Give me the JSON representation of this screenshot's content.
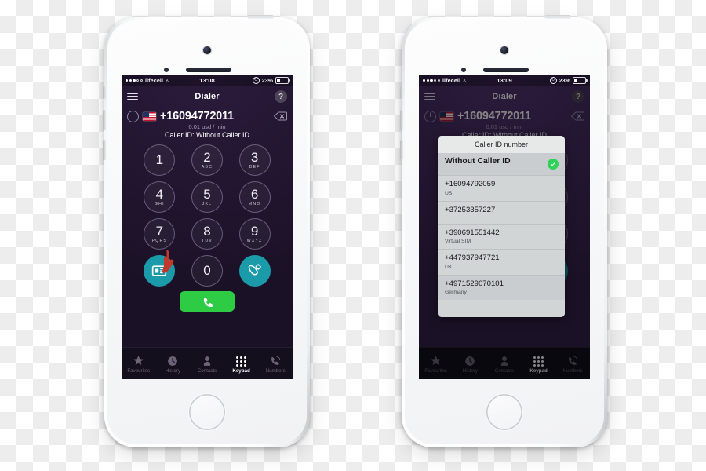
{
  "statusbar": {
    "carrier": "lifecell",
    "signal_dots_filled": 3,
    "signal_dots_empty": 2,
    "wifi_icon": "wifi-icon",
    "time_left": "13:08",
    "time_right": "13:09",
    "lock_icon": "rotation-lock-icon",
    "battery_percent": "23%"
  },
  "navbar": {
    "menu_icon": "hamburger-menu-icon",
    "title": "Dialer",
    "help_label": "?"
  },
  "dialer": {
    "add_icon": "plus-circle-icon",
    "flag_icon": "us-flag-icon",
    "number": "+16094772011",
    "backspace_icon": "backspace-icon",
    "rate": "0.01 usd / min",
    "caller_id_line": "Caller ID: Without Caller ID"
  },
  "keypad": {
    "keys": [
      {
        "digit": "1",
        "letters": ""
      },
      {
        "digit": "2",
        "letters": "ABC"
      },
      {
        "digit": "3",
        "letters": "DEF"
      },
      {
        "digit": "4",
        "letters": "GHI"
      },
      {
        "digit": "5",
        "letters": "JKL"
      },
      {
        "digit": "6",
        "letters": "MNO"
      },
      {
        "digit": "7",
        "letters": "PQRS"
      },
      {
        "digit": "8",
        "letters": "TUV"
      },
      {
        "digit": "9",
        "letters": "WXYZ"
      },
      {
        "digit": "0",
        "letters": ""
      }
    ],
    "caller_id_icon": "caller-id-card-icon",
    "settings_icon": "phone-settings-icon",
    "call_icon": "phone-handset-icon",
    "cursor_icon": "pointing-hand-cursor"
  },
  "tabbar": {
    "tabs": [
      {
        "label": "Favourites",
        "icon": "star-icon",
        "active": false
      },
      {
        "label": "History",
        "icon": "clock-icon",
        "active": false
      },
      {
        "label": "Contacts",
        "icon": "person-icon",
        "active": false
      },
      {
        "label": "Keypad",
        "icon": "keypad-grid-icon",
        "active": true
      },
      {
        "label": "Numbers",
        "icon": "phone-waves-icon",
        "active": false
      }
    ]
  },
  "modal": {
    "title": "Caller ID number",
    "check_icon": "green-check-icon",
    "rows": [
      {
        "title": "Without Caller ID",
        "subtitle": "",
        "selected": true,
        "checked": true
      },
      {
        "title": "+16094792059",
        "subtitle": "US",
        "selected": false,
        "checked": false
      },
      {
        "title": "+37253357227",
        "subtitle": "",
        "selected": false,
        "checked": false
      },
      {
        "title": "+390691551442",
        "subtitle": "Virtual SIM",
        "selected": false,
        "checked": false
      },
      {
        "title": "+447937947721",
        "subtitle": "UK",
        "selected": false,
        "checked": false
      },
      {
        "title": "+4971529070101",
        "subtitle": "Germany",
        "selected": true,
        "checked": false
      }
    ]
  },
  "colors": {
    "accent_teal": "#1b9aaa",
    "call_green": "#2ecc45",
    "check_green": "#30d158",
    "screen_bg": "#241733",
    "cursor_red": "#c0392b"
  }
}
